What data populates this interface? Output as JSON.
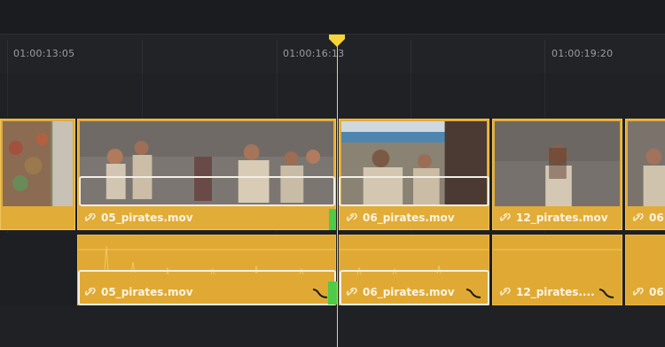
{
  "timeline": {
    "ruler": {
      "timecodes": [
        "01:00:13:05",
        "01:00:16:13",
        "01:00:19:20"
      ]
    },
    "video_track": {
      "clips": [
        {
          "name": ""
        },
        {
          "name": "05_pirates.mov"
        },
        {
          "name": "06_pirates.mov"
        },
        {
          "name": "12_pirates.mov"
        },
        {
          "name": "06"
        }
      ]
    },
    "audio_track": {
      "clips": [
        {
          "name": ""
        },
        {
          "name": "05_pirates.mov"
        },
        {
          "name": "06_pirates.mov"
        },
        {
          "name": "12_pirates...."
        },
        {
          "name": "06"
        }
      ]
    },
    "colors": {
      "clip": "#e2ac38",
      "playhead": "#f6d438",
      "transition_marker": "#4ecb49",
      "background": "#1f2023"
    },
    "icons": [
      "link-icon",
      "audio-fade-icon",
      "playhead-marker-icon"
    ]
  }
}
